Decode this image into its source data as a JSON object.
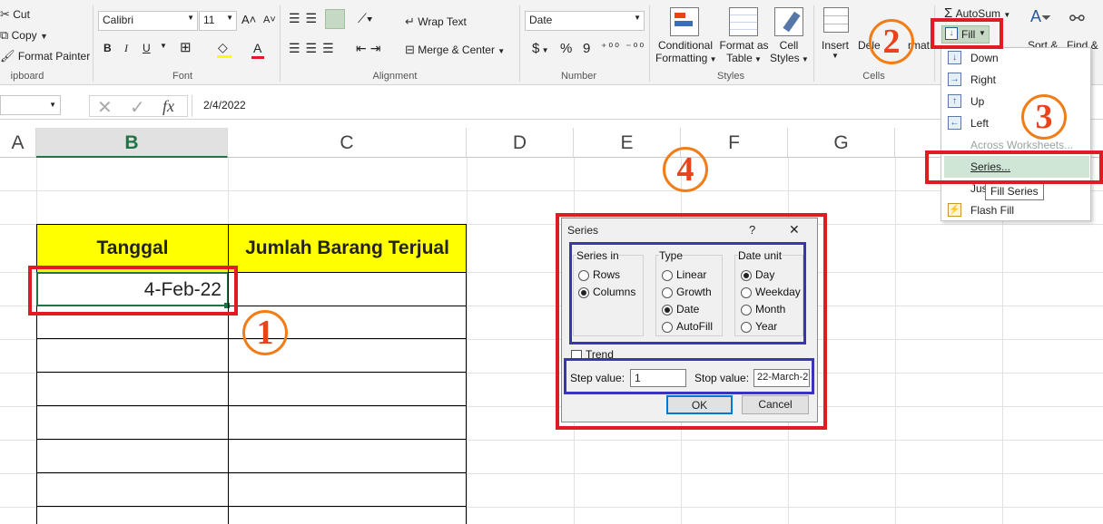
{
  "ribbon": {
    "clipboard": {
      "cut": "Cut",
      "copy": "Copy",
      "format_painter": "Format Painter",
      "group": "ipboard"
    },
    "font": {
      "name": "Calibri",
      "size": "11",
      "bold": "B",
      "italic": "I",
      "underline": "U",
      "grow": "A˄",
      "shrink": "A˅",
      "font_color": "A",
      "group": "Font"
    },
    "alignment": {
      "wrap_text": "Wrap Text",
      "merge_center": "Merge & Center",
      "group": "Alignment"
    },
    "number": {
      "format": "Date",
      "currency": "$",
      "percent": "%",
      "comma": "9",
      "group": "Number"
    },
    "styles": {
      "conditional_1": "Conditional",
      "conditional_2": "Formatting",
      "format_table_1": "Format as",
      "format_table_2": "Table",
      "cell_styles_1": "Cell",
      "cell_styles_2": "Styles",
      "group": "Styles"
    },
    "cells": {
      "insert": "Insert",
      "delete": "Dele",
      "format": "rmat",
      "group": "Cells"
    },
    "editing": {
      "autosum": "AutoSum",
      "fill": "Fill",
      "sort": "Sort &",
      "find": "Find &"
    }
  },
  "formula_bar": {
    "name_box": "",
    "fx": "fx",
    "value": "2/4/2022"
  },
  "columns": [
    "A",
    "B",
    "C",
    "D",
    "E",
    "F",
    "G"
  ],
  "cells": {
    "b_header": "Tanggal",
    "c_header": "Jumlah Barang Terjual",
    "b_value": "4-Feb-22"
  },
  "fill_menu": {
    "items": [
      "Down",
      "Right",
      "Up",
      "Left",
      "Across Worksheets...",
      "Series...",
      "Justify",
      "Flash Fill"
    ],
    "tooltip": "Fill Series"
  },
  "dialog": {
    "title": "Series",
    "help": "?",
    "close": "✕",
    "series_in": {
      "label": "Series in",
      "options": [
        "Rows",
        "Columns"
      ],
      "selected": "Columns"
    },
    "type": {
      "label": "Type",
      "options": [
        "Linear",
        "Growth",
        "Date",
        "AutoFill"
      ],
      "selected": "Date"
    },
    "date_unit": {
      "label": "Date unit",
      "options": [
        "Day",
        "Weekday",
        "Month",
        "Year"
      ],
      "selected": "Day"
    },
    "trend": "Trend",
    "step_label": "Step value:",
    "step_value": "1",
    "stop_label": "Stop value:",
    "stop_value": "22-March-2",
    "ok": "OK",
    "cancel": "Cancel"
  },
  "badges": [
    "1",
    "2",
    "3",
    "4"
  ],
  "colors": {
    "highlight": "#ffff00",
    "annotation_red": "#e01b24",
    "annotation_blue": "#3a35b8",
    "badge": "#f07d18",
    "selected_col": "#217346"
  }
}
